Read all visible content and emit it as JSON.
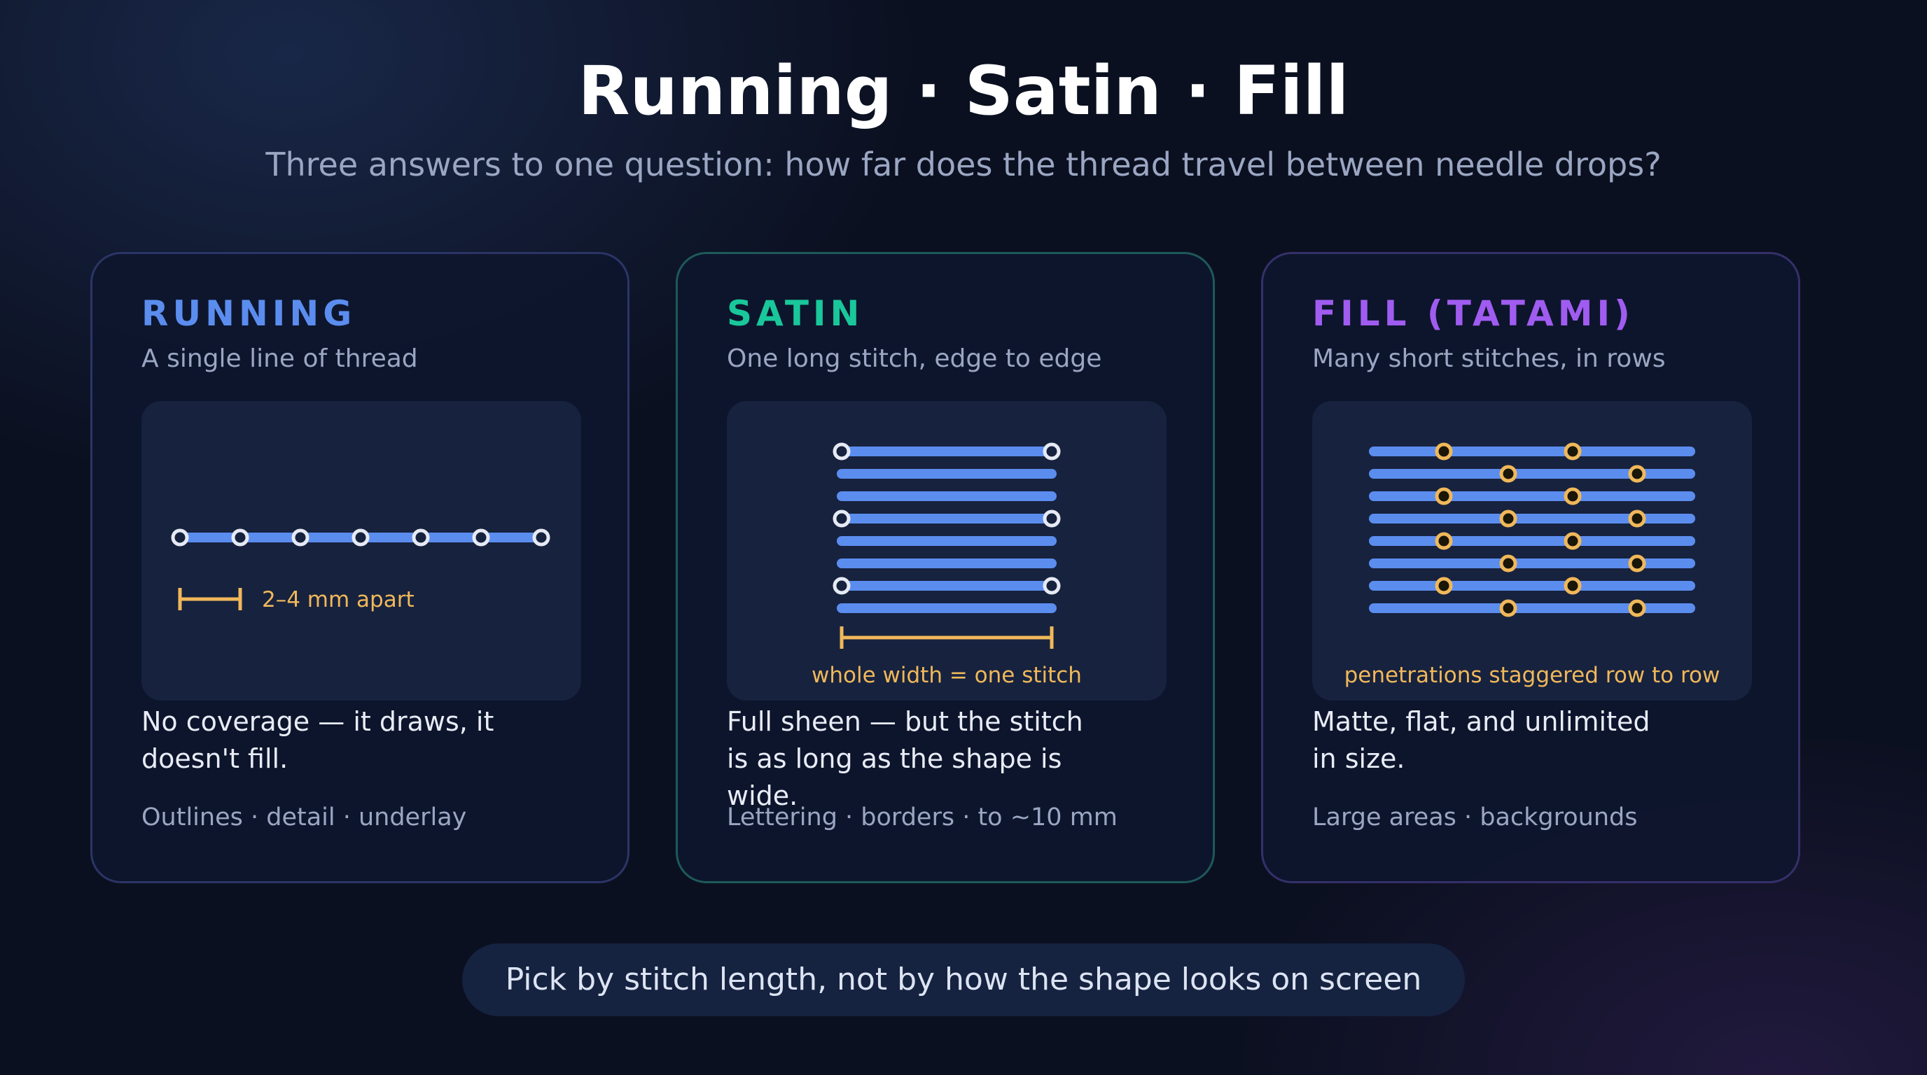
{
  "title": "Running · Satin · Fill",
  "subtitle": "Three answers to one question: how far does the thread travel between needle drops?",
  "colors": {
    "thread": "#5b8def",
    "point_light": "#e6eaf4",
    "point_amber": "#f0b85a",
    "annotation": "#f0b85a",
    "running": "#5b8def",
    "satin": "#19c79a",
    "fill": "#a05cf0"
  },
  "cards": [
    {
      "title": "RUNNING",
      "subtitle": "A single line of thread",
      "annotation": "2–4 mm apart",
      "description": "No coverage — it draws, it doesn't fill.",
      "uses": "Outlines · detail · underlay"
    },
    {
      "title": "SATIN",
      "subtitle": "One long stitch, edge to edge",
      "annotation": "whole width = one stitch",
      "description": "Full sheen — but the stitch is as long as the shape is wide.",
      "uses": "Lettering · borders · to ~10 mm"
    },
    {
      "title": "FILL (TATAMI)",
      "subtitle": "Many short stitches, in rows",
      "annotation": "penetrations staggered row to row",
      "description": "Matte, flat, and unlimited in size.",
      "uses": "Large areas · backgrounds"
    }
  ],
  "footer": "Pick by stitch length, not by how the shape looks on screen"
}
